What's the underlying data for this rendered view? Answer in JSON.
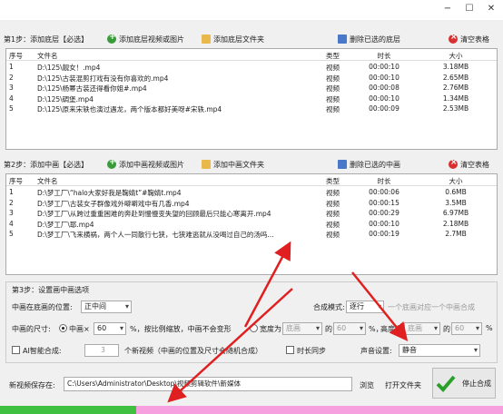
{
  "window": {
    "minimize": "−",
    "maximize": "☐",
    "close": "✕"
  },
  "step1": {
    "title": "第1步：添加底层【必选】",
    "add_media": "添加底层视频或图片",
    "add_folder": "添加底层文件夹",
    "delete_selected": "删除已选的底层",
    "clear_table": "清空表格",
    "columns": [
      "序号",
      "文件名",
      "类型",
      "时长",
      "大小"
    ],
    "rows": [
      [
        "1",
        "D:\\125\\靓女！.mp4",
        "视频",
        "00:00:10",
        "3.18MB"
      ],
      [
        "2",
        "D:\\125\\古装混剪打戏有没有你喜欢的.mp4",
        "视频",
        "00:00:10",
        "2.65MB"
      ],
      [
        "3",
        "D:\\125\\杨幂古装还得看你姐#.mp4",
        "视频",
        "00:00:08",
        "2.76MB"
      ],
      [
        "4",
        "D:\\125\\碉堡.mp4",
        "视频",
        "00:00:10",
        "1.34MB"
      ],
      [
        "5",
        "D:\\125\\原来宋轶也演过遇龙，两个版本都好美呀#宋轶.mp4",
        "视频",
        "00:00:09",
        "2.53MB"
      ]
    ]
  },
  "step2": {
    "title": "第2步：添加中画【必选】",
    "add_media": "添加中画视频或图片",
    "add_folder": "添加中画文件夹",
    "delete_selected": "删除已选的中画",
    "clear_table": "清空表格",
    "columns": [
      "序号",
      "文件名",
      "类型",
      "时长",
      "大小"
    ],
    "rows": [
      [
        "1",
        "D:\\梦工厂\\“halo大家好我是鞠婧t”#鞠婧t.mp4",
        "视频",
        "00:00:06",
        "0.6MB"
      ],
      [
        "2",
        "D:\\梦工厂\\古装女子群像戏外噼噼戏中有几香.mp4",
        "视频",
        "00:00:15",
        "3.5MB"
      ],
      [
        "3",
        "D:\\梦工厂\\从跨过重重困难的奔赴到慢慢变失望的回顾最后只能心寒离开.mp4",
        "视频",
        "00:00:29",
        "6.97MB"
      ],
      [
        "4",
        "D:\\梦工厂\\耶.mp4",
        "视频",
        "00:00:10",
        "2.18MB"
      ],
      [
        "5",
        "D:\\梦工厂\\飞来横祸，两个人一同散行七狭，七狭难逃就从没喝过自己的汤吗...",
        "视频",
        "00:00:19",
        "2.7MB"
      ]
    ]
  },
  "step3": {
    "title": "第3步：设置画中画选项",
    "position_label": "中画在底画的位置:",
    "position_value": "正中间",
    "mode_label": "合成模式:",
    "mode_value": "逐行",
    "mode_desc": "一个底画对应一个中画合成",
    "size_label": "中画的尺寸:",
    "size_mid_label": "中画×",
    "size_mid_value": "60",
    "size_mid_suffix": "%，按比例缩放，中画不会变形",
    "width_label": "宽度为",
    "width_base": "底画",
    "width_of": "的",
    "width_pct": "60",
    "width_suffix": "%，",
    "height_label": "高度为",
    "height_base": "底画",
    "height_of": "的",
    "height_pct": "60",
    "height_suffix": "%",
    "ai_label": "AI智能合成:",
    "ai_count": "3",
    "ai_desc": "个新视频（中画的位置及尺寸会随机合成）",
    "sync_label": "时长同步",
    "audio_label": "声音设置:",
    "audio_value": "静音"
  },
  "save": {
    "label": "新视频保存在:",
    "path": "C:\\Users\\Administrator\\Desktop\\视频剪辑软件\\新媒体",
    "browse": "浏览",
    "open_folder": "打开文件夹",
    "stop": "停止合成"
  },
  "progress": {
    "fraction": 0.27
  },
  "colors": {
    "accent_green": "#40c040",
    "progress_rest": "#f6a0e0",
    "annotation_red": "#e02020"
  }
}
